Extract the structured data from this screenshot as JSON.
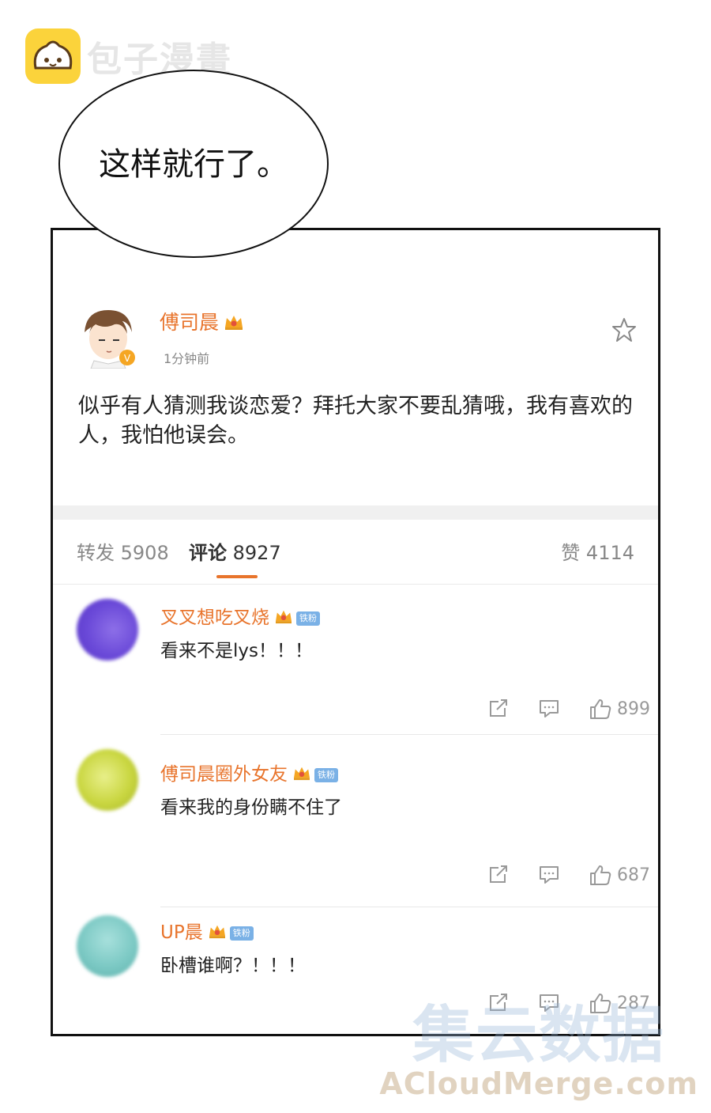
{
  "watermark_top": {
    "text": "包子漫畫",
    "logo": "bun-logo-icon"
  },
  "bubble": {
    "text": "这样就行了。"
  },
  "post": {
    "author": "傅司晨",
    "time": "1分钟前",
    "body": "似乎有人猜测我谈恋爱？拜托大家不要乱猜哦，我有喜欢的人，我怕他误会。"
  },
  "tabs": {
    "forward_label": "转发",
    "forward_count": "5908",
    "comment_label": "评论",
    "comment_count": "8927",
    "like_label": "赞",
    "like_count": "4114"
  },
  "comments": [
    {
      "name": "叉叉想吃叉烧",
      "badge": "铁粉",
      "text": "看来不是lys！！！",
      "likes": "899",
      "avatar_color": "#6a49d8"
    },
    {
      "name": "傅司晨圈外女友",
      "badge": "铁粉",
      "text": "看来我的身份瞒不住了",
      "likes": "687",
      "avatar_color": "#c9d640"
    },
    {
      "name": "UP晨",
      "badge": "铁粉",
      "text": "卧槽谁啊？！！！",
      "likes": "287",
      "avatar_color": "#7cc9c4"
    }
  ],
  "watermark_bottom": {
    "cn": "集云数据",
    "en": "ACloudMerge.com"
  },
  "colors": {
    "accent": "#e8742c",
    "badge": "#7ab1e6",
    "logo": "#fbd33b"
  }
}
